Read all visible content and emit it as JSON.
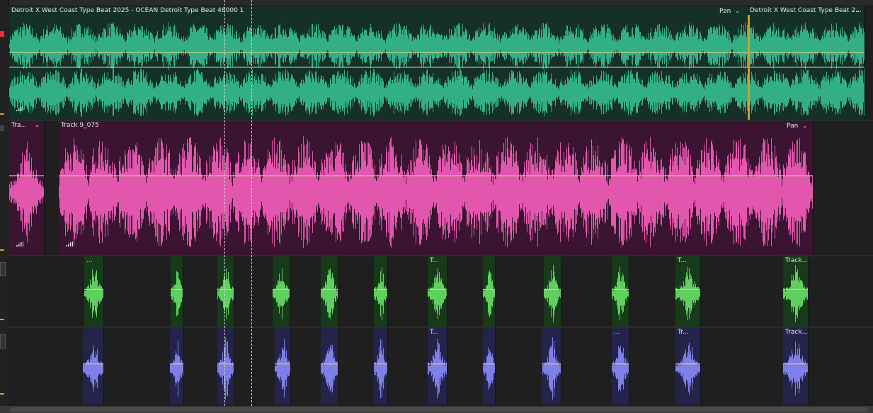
{
  "colors": {
    "teal_bg": "#143028",
    "teal_wave": "#33b083",
    "pink_bg": "#3a1430",
    "pink_wave": "#e257ad",
    "green_bg": "#163a1a",
    "green_wave": "#5fcf5f",
    "blue_bg": "#24244a",
    "blue_wave": "#7f7fe8",
    "automation": "#d4c68a",
    "marker": "#c8a22a"
  },
  "tracks": [
    {
      "id": "track1",
      "clips": [
        {
          "title": "Detroit X West Coast Type Beat 2025 - OCEAN Detroit Type Beat 48000 1",
          "pan_label": "Pan",
          "has_pan": true
        },
        {
          "title": "Detroit X West Coast Type Beat 2...",
          "pan_label": "",
          "has_pan": false
        }
      ]
    },
    {
      "id": "track2",
      "clips": [
        {
          "title": "Tra...",
          "pan_label": "",
          "has_pan": false
        },
        {
          "title": "Track 9_075",
          "pan_label": "Pan",
          "has_pan": true
        }
      ]
    },
    {
      "id": "track3",
      "clips": [
        {
          "title": "..."
        },
        {
          "title": ""
        },
        {
          "title": ""
        },
        {
          "title": ""
        },
        {
          "title": ""
        },
        {
          "title": ""
        },
        {
          "title": "T..."
        },
        {
          "title": ""
        },
        {
          "title": ""
        },
        {
          "title": ""
        },
        {
          "title": "T..."
        },
        {
          "title": "Track..."
        }
      ]
    },
    {
      "id": "track4",
      "clips": [
        {
          "title": ""
        },
        {
          "title": ""
        },
        {
          "title": ""
        },
        {
          "title": ""
        },
        {
          "title": ""
        },
        {
          "title": ""
        },
        {
          "title": "T..."
        },
        {
          "title": ""
        },
        {
          "title": ""
        },
        {
          "title": "..."
        },
        {
          "title": "Tr..."
        },
        {
          "title": "Track..."
        }
      ]
    }
  ]
}
